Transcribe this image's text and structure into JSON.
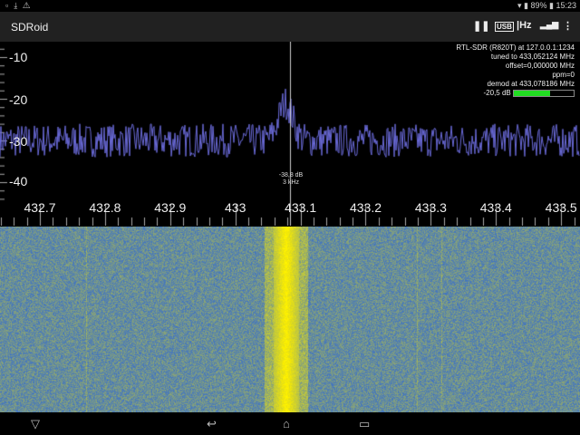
{
  "status_bar": {
    "left_icons": [
      "notification-icon",
      "download-icon",
      "warning-icon"
    ],
    "battery": "89%",
    "time": "15:23"
  },
  "toolbar": {
    "title": "SDRoid",
    "buttons": [
      {
        "name": "pause-button",
        "icon": "pause-icon",
        "label": "❚❚"
      },
      {
        "name": "usb-button",
        "icon": "usb-icon",
        "label": "USB"
      },
      {
        "name": "bandwidth-button",
        "icon": "hz-icon",
        "label": "|Hz"
      },
      {
        "name": "signal-button",
        "icon": "signal-bars-icon",
        "label": "▂▄▆"
      },
      {
        "name": "overflow-menu-button",
        "icon": "more-vert-icon",
        "label": "⋮"
      }
    ]
  },
  "spectrum": {
    "y_ticks": [
      "-10",
      "-20",
      "-30",
      "-40"
    ],
    "y_values": [
      -10,
      -20,
      -30,
      -40
    ],
    "x_ticks": [
      "432.7",
      "432.8",
      "432.9",
      "433",
      "433.1",
      "433.2",
      "433.3",
      "433.4",
      "433.5"
    ],
    "x_values": [
      432.7,
      432.8,
      432.9,
      433.0,
      433.1,
      433.2,
      433.3,
      433.4,
      433.5
    ],
    "trace_color": "#6a6ad8",
    "noise_floor_db": -30,
    "peak_db": -21,
    "marker": {
      "level": "-38,8 dB",
      "bandwidth": "3 kHz"
    },
    "info": {
      "device": "RTL-SDR (R820T) at 127.0.0.1:1234",
      "tuned": "tuned to 433,052124 MHz",
      "offset": "offset=0,000000 MHz",
      "ppm": "ppm=0",
      "demod": "demod at 433,078186 MHz",
      "level": "-20,5 dB",
      "level_fraction": 0.6,
      "meter_color": "#22dd22"
    }
  },
  "waterfall": {
    "background_color": "#3a6fd8",
    "signal_color": "#ffee00",
    "signal_freq_mhz": 433.08
  },
  "nav": {
    "back": "⌄",
    "home": "↩",
    "recents": "⌂",
    "apps": "▭"
  }
}
